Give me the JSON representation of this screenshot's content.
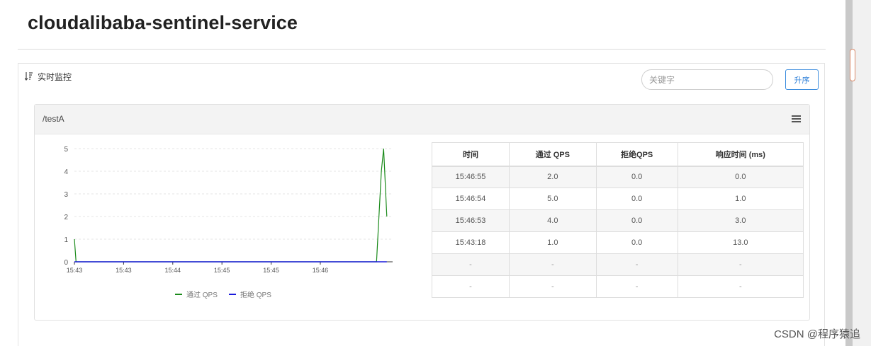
{
  "app": {
    "title": "cloudalibaba-sentinel-service"
  },
  "panel": {
    "header_label": "实时监控",
    "search_placeholder": "关键字",
    "sort_label": "升序"
  },
  "card": {
    "title": "/testA"
  },
  "chart_data": {
    "type": "line",
    "x": [
      "15:43",
      "15:43",
      "15:44",
      "15:45",
      "15:45",
      "15:46"
    ],
    "ylim": [
      0,
      5
    ],
    "yticks": [
      0,
      1,
      2,
      3,
      4,
      5
    ],
    "grid": true,
    "legend_position": "bottom",
    "series": [
      {
        "name": "通过 QPS",
        "color": "#1a8a1a",
        "points": [
          [
            0.0,
            1.0
          ],
          [
            0.05,
            0.0
          ],
          [
            9.4,
            0.0
          ],
          [
            9.55,
            4.0
          ],
          [
            9.62,
            5.0
          ],
          [
            9.72,
            2.0
          ]
        ]
      },
      {
        "name": "拒绝 QPS",
        "color": "#1a1adc",
        "points": [
          [
            0.0,
            0.0
          ],
          [
            9.72,
            0.0
          ]
        ]
      }
    ]
  },
  "table": {
    "headers": [
      "时间",
      "通过 QPS",
      "拒绝QPS",
      "响应时间 (ms)"
    ],
    "rows": [
      [
        "15:46:55",
        "2.0",
        "0.0",
        "0.0"
      ],
      [
        "15:46:54",
        "5.0",
        "0.0",
        "1.0"
      ],
      [
        "15:46:53",
        "4.0",
        "0.0",
        "3.0"
      ],
      [
        "15:43:18",
        "1.0",
        "0.0",
        "13.0"
      ],
      [
        "-",
        "-",
        "-",
        "-"
      ],
      [
        "-",
        "-",
        "-",
        "-"
      ]
    ]
  },
  "watermark": "CSDN @程序猿追"
}
